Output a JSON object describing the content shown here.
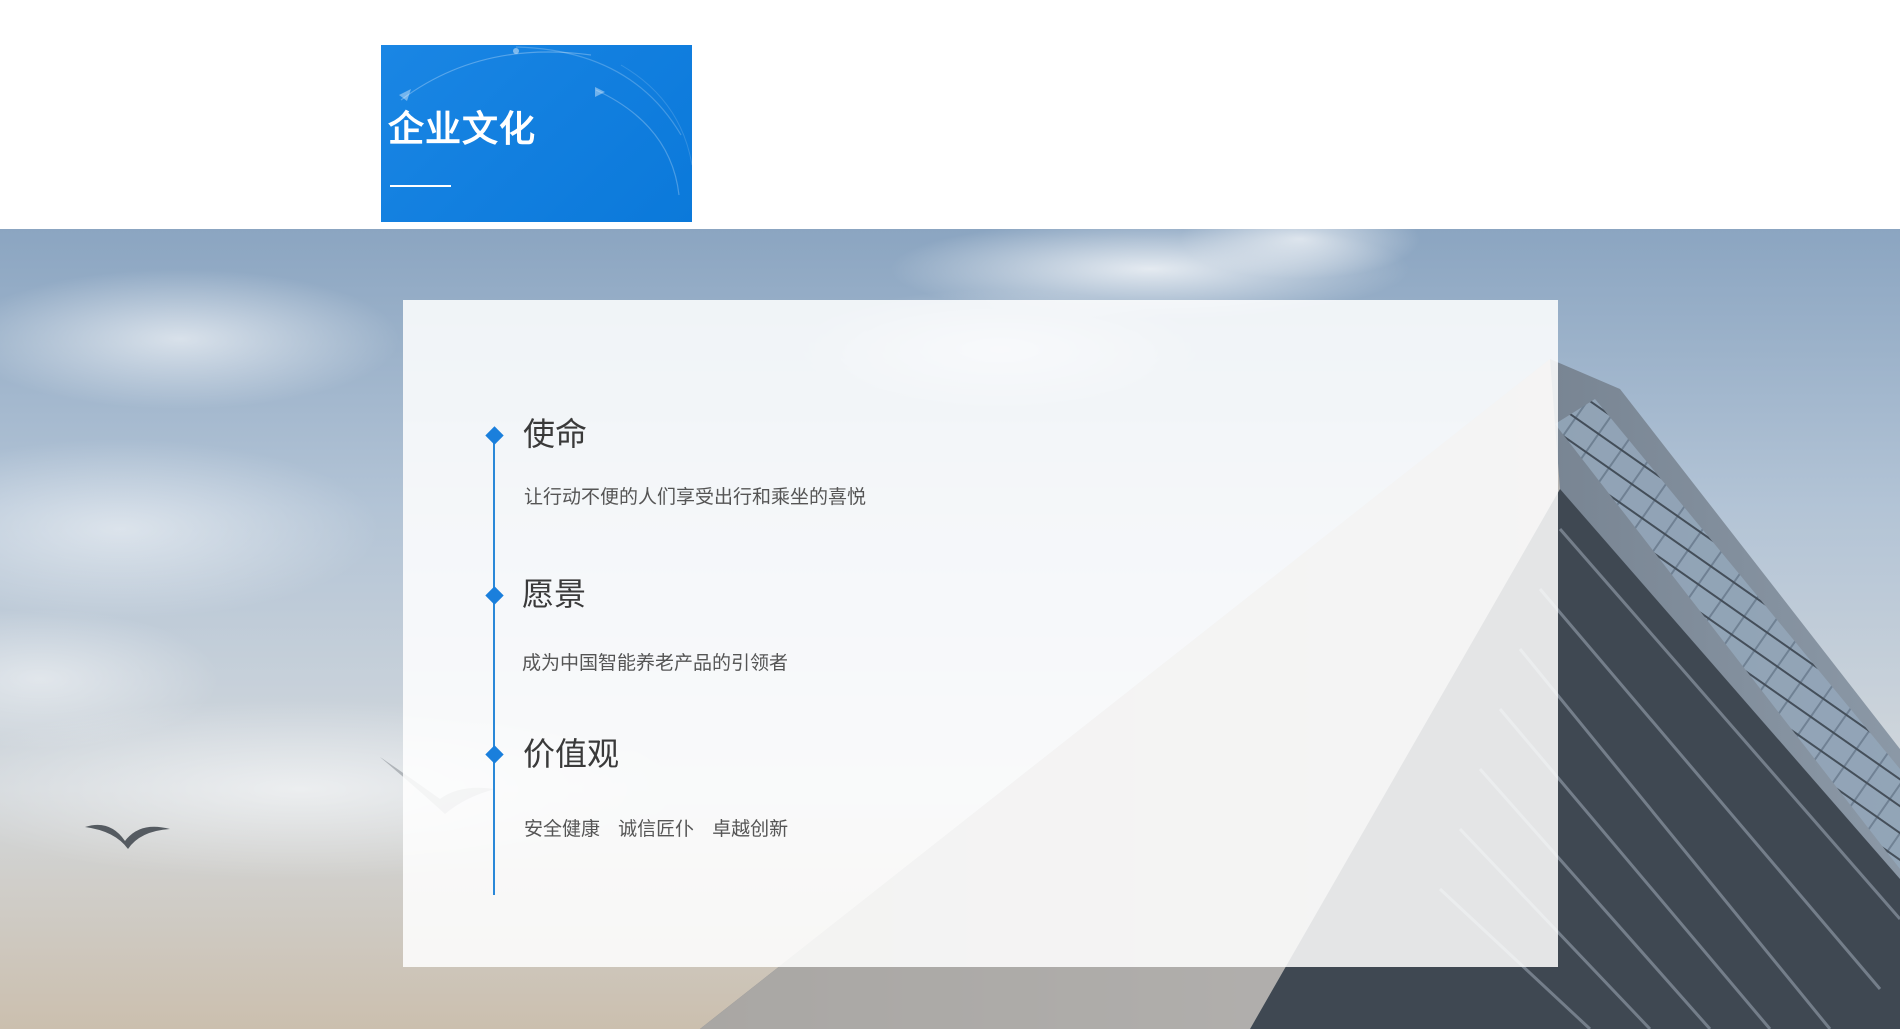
{
  "header": {
    "title": "企业文化"
  },
  "culture": {
    "sections": [
      {
        "title": "使命",
        "description": "让行动不便的人们享受出行和乘坐的喜悦"
      },
      {
        "title": "愿景",
        "description": "成为中国智能养老产品的引领者"
      },
      {
        "title": "价值观",
        "values": [
          "安全健康",
          "诚信匠仆",
          "卓越创新"
        ]
      }
    ]
  },
  "colors": {
    "accent": "#127fdf",
    "title_text": "#3a3a3a",
    "desc_text": "#555555"
  },
  "icons": {
    "bullet": "diamond-icon"
  }
}
